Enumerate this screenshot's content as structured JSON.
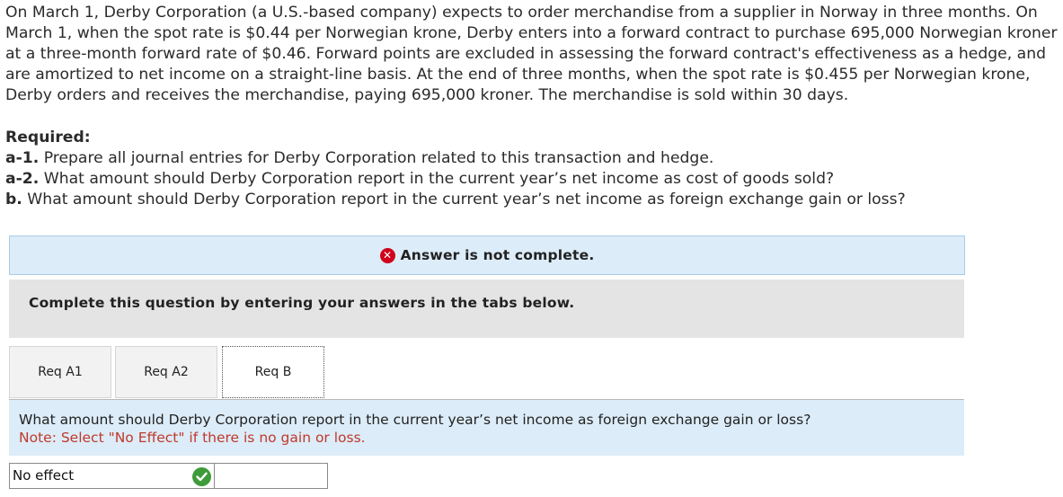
{
  "problem": {
    "text": "On March 1, Derby Corporation (a U.S.-based company) expects to order merchandise from a supplier in Norway in three months. On March 1, when the spot rate is $0.44 per Norwegian krone, Derby enters into a forward contract to purchase 695,000 Norwegian kroner at a three-month forward rate of $0.46. Forward points are excluded in assessing the forward contract's effectiveness as a hedge, and are amortized to net income on a straight-line basis. At the end of three months, when the spot rate is $0.455 per Norwegian krone, Derby orders and receives the merchandise, paying 695,000 kroner. The merchandise is sold within 30 days."
  },
  "required": {
    "heading": "Required:",
    "items": [
      {
        "label": "a-1.",
        "text": " Prepare all journal entries for Derby Corporation related to this transaction and hedge."
      },
      {
        "label": "a-2.",
        "text": " What amount should Derby Corporation report in the current year’s net income as cost of goods sold?"
      },
      {
        "label": "b.",
        "text": " What amount should Derby Corporation report in the current year’s net income as foreign exchange gain or loss?"
      }
    ]
  },
  "banner": {
    "text": "Answer is not complete.",
    "icon": "x-circle-icon",
    "color": "#d0021b"
  },
  "instructions": {
    "text": "Complete this question by entering your answers in the tabs below."
  },
  "tabs": [
    {
      "label": "Req A1",
      "active": false
    },
    {
      "label": "Req A2",
      "active": false
    },
    {
      "label": "Req B",
      "active": true
    }
  ],
  "question": {
    "text": "What amount should Derby Corporation report in the current year’s net income as foreign exchange gain or loss?",
    "note": "Note: Select \"No Effect\" if there is no gain or loss."
  },
  "answer": {
    "selected": "No effect",
    "status": "correct",
    "status_icon": "check-circle-icon",
    "status_color": "#3e9b3a",
    "amount": ""
  }
}
